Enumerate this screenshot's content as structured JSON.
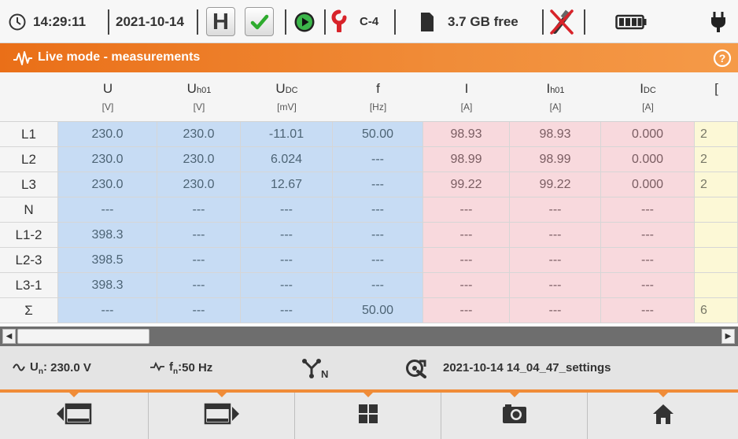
{
  "status_bar": {
    "time": "14:29:11",
    "date": "2021-10-14",
    "hold_label": "H",
    "clamp_label": "C-4",
    "storage_free": "3.7 GB free",
    "icons": [
      "clock-icon",
      "hold-icon",
      "check-icon",
      "record-icon",
      "clamp-icon",
      "sd-card-icon",
      "usb-disconnected-icon",
      "battery-icon",
      "power-plug-icon"
    ]
  },
  "title_bar": {
    "title": "Live mode - measurements",
    "icons": [
      "waveform-icon",
      "help-icon"
    ]
  },
  "table": {
    "columns": [
      {
        "symbol": "U",
        "sub": "",
        "unit": "[V]"
      },
      {
        "symbol": "U",
        "sub": "h01",
        "unit": "[V]"
      },
      {
        "symbol": "U",
        "sub": "DC",
        "unit": "[mV]"
      },
      {
        "symbol": "f",
        "sub": "",
        "unit": "[Hz]"
      },
      {
        "symbol": "I",
        "sub": "",
        "unit": "[A]"
      },
      {
        "symbol": "I",
        "sub": "h01",
        "unit": "[A]"
      },
      {
        "symbol": "I",
        "sub": "DC",
        "unit": "[A]"
      },
      {
        "symbol": "[",
        "sub": "",
        "unit": ""
      }
    ],
    "rows": [
      {
        "label": "L1",
        "values": [
          "230.0",
          "230.0",
          "-11.01",
          "50.00",
          "98.93",
          "98.93",
          "0.000",
          "2"
        ]
      },
      {
        "label": "L2",
        "values": [
          "230.0",
          "230.0",
          "6.024",
          "---",
          "98.99",
          "98.99",
          "0.000",
          "2"
        ]
      },
      {
        "label": "L3",
        "values": [
          "230.0",
          "230.0",
          "12.67",
          "---",
          "99.22",
          "99.22",
          "0.000",
          "2"
        ]
      },
      {
        "label": "N",
        "values": [
          "---",
          "---",
          "---",
          "---",
          "---",
          "---",
          "---",
          ""
        ]
      },
      {
        "label": "L1-2",
        "values": [
          "398.3",
          "---",
          "---",
          "---",
          "---",
          "---",
          "---",
          ""
        ]
      },
      {
        "label": "L2-3",
        "values": [
          "398.5",
          "---",
          "---",
          "---",
          "---",
          "---",
          "---",
          ""
        ]
      },
      {
        "label": "L3-1",
        "values": [
          "398.3",
          "---",
          "---",
          "---",
          "---",
          "---",
          "---",
          ""
        ]
      },
      {
        "label": "Σ",
        "values": [
          "---",
          "---",
          "---",
          "50.00",
          "---",
          "---",
          "---",
          "6"
        ]
      }
    ]
  },
  "scrollbar": {
    "left_arrow": "◀",
    "right_arrow": "▶",
    "position": 0.0
  },
  "info_bar": {
    "nominal_voltage": "230.0 V",
    "nominal_frequency": "50 Hz",
    "settings_file": "2021-10-14 14_04_47_settings",
    "icons": [
      "sine-wave-icon",
      "frequency-icon",
      "network-type-icon",
      "settings-file-icon"
    ]
  },
  "buttons": [
    {
      "name": "previous-screen-button",
      "icon": "screen-left-icon"
    },
    {
      "name": "next-screen-button",
      "icon": "screen-right-icon"
    },
    {
      "name": "view-tiles-button",
      "icon": "grid-icon"
    },
    {
      "name": "screenshot-button",
      "icon": "camera-icon"
    },
    {
      "name": "home-button",
      "icon": "home-icon"
    }
  ],
  "colors": {
    "accent": "#f08c38",
    "voltage_cells": "#c7dcf4",
    "current_cells": "#f8d9dd",
    "power_cells": "#fcf8d6"
  }
}
